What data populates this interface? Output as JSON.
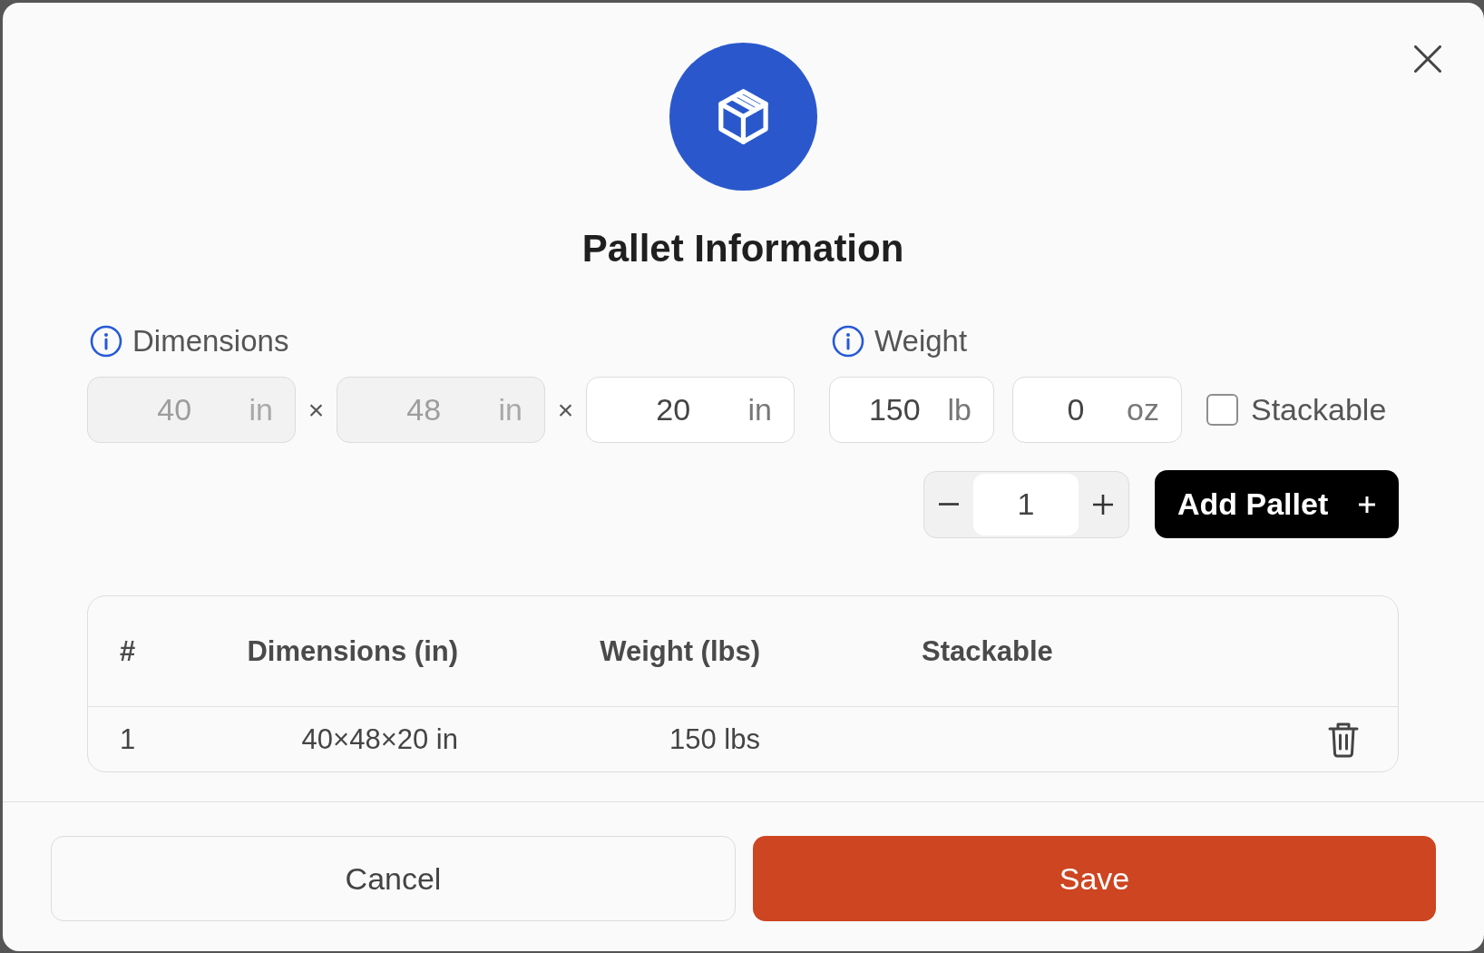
{
  "dialog": {
    "title": "Pallet Information"
  },
  "dimensions": {
    "label": "Dimensions",
    "fields": [
      {
        "value": "40",
        "unit": "in",
        "disabled": true
      },
      {
        "value": "48",
        "unit": "in",
        "disabled": true
      },
      {
        "value": "20",
        "unit": "in",
        "disabled": false
      }
    ],
    "separators": [
      "×",
      "×"
    ]
  },
  "weight": {
    "label": "Weight",
    "fields": [
      {
        "value": "150",
        "unit": "lb",
        "disabled": false
      },
      {
        "value": "0",
        "unit": "oz",
        "disabled": false
      }
    ]
  },
  "stackable": {
    "label": "Stackable",
    "checked": false
  },
  "quantity": {
    "value": "1"
  },
  "add_button": {
    "label": "Add Pallet"
  },
  "table": {
    "columns": [
      "#",
      "Dimensions (in)",
      "Weight (lbs)",
      "Stackable"
    ],
    "rows": [
      {
        "cells": [
          "1",
          "40×48×20 in",
          "150 lbs"
        ]
      }
    ]
  },
  "footer": {
    "buttons": [
      {
        "label": "Cancel",
        "kind": "secondary"
      },
      {
        "label": "Save",
        "kind": "primary"
      }
    ]
  }
}
